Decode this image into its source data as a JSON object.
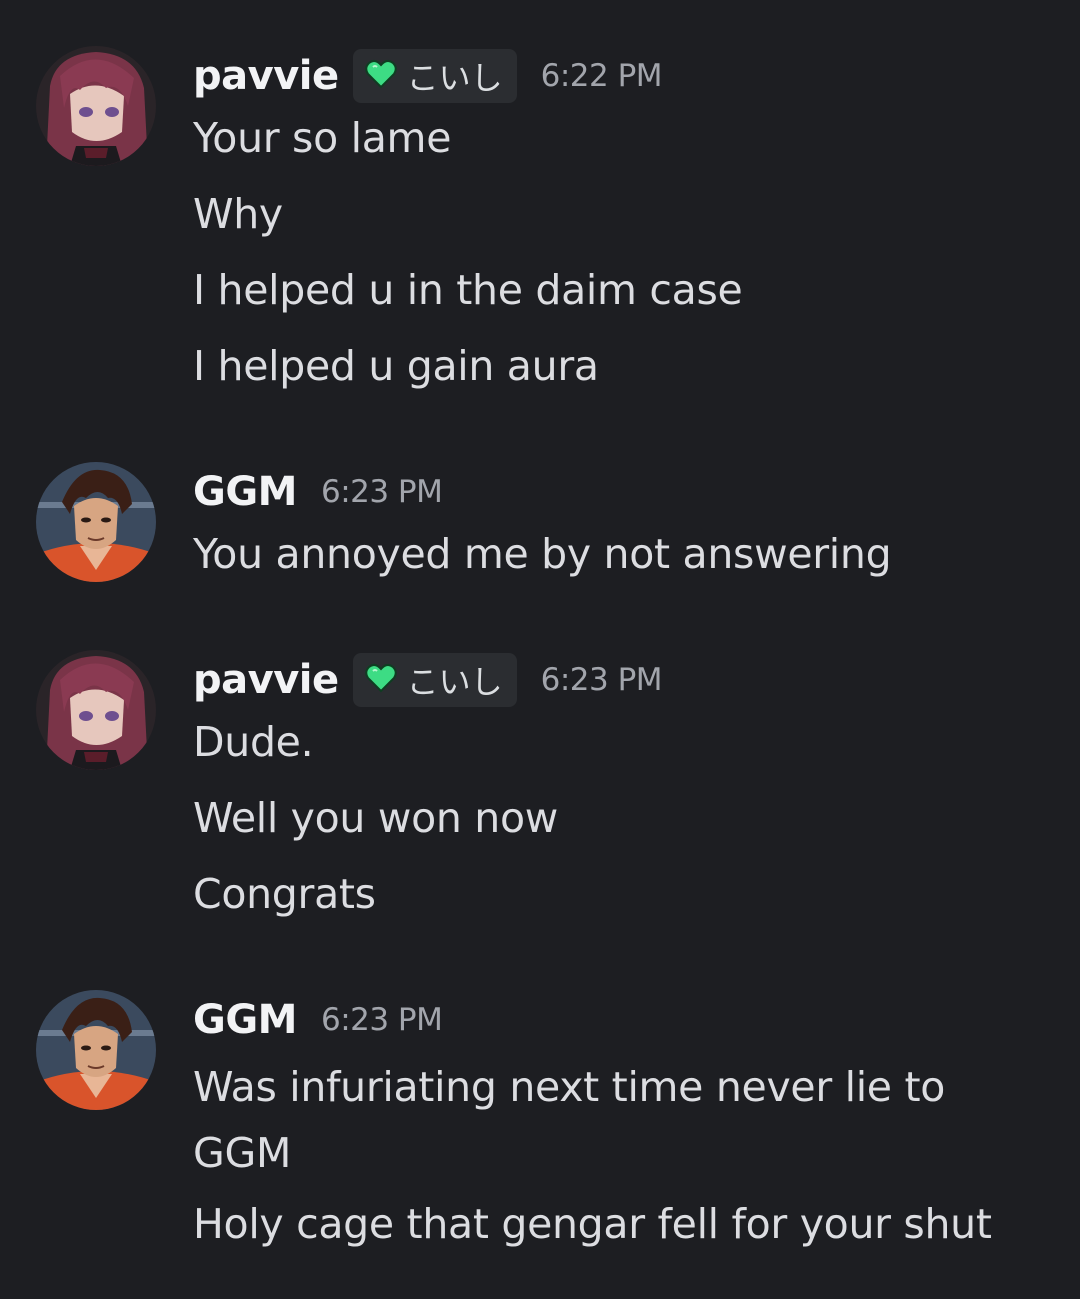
{
  "messages": [
    {
      "author": "pavvie",
      "tag": "こいし",
      "time": "6:22 PM",
      "lines": [
        "Your so lame",
        "Why",
        "I helped u in the daim case",
        "I helped u gain aura"
      ]
    },
    {
      "author": "GGM",
      "time": "6:23 PM",
      "lines": [
        "You annoyed me by not answering"
      ]
    },
    {
      "author": "pavvie",
      "tag": "こいし",
      "time": "6:23 PM",
      "lines": [
        "Dude.",
        "Well you won now",
        "Congrats"
      ]
    },
    {
      "author": "GGM",
      "time": "6:23 PM",
      "lines": [
        "Was infuriating next time never lie to GGM",
        "Holy cage that gengar fell for your shut"
      ]
    }
  ],
  "colors": {
    "background": "#1d1e22",
    "username": "#f2f3f5",
    "text": "#dcdde1",
    "timestamp": "#a2a5ac",
    "tag_bg": "#2b2d31",
    "tag_heart": "#3ddc84"
  },
  "icons": {
    "tag_icon": "green-heart-icon"
  }
}
